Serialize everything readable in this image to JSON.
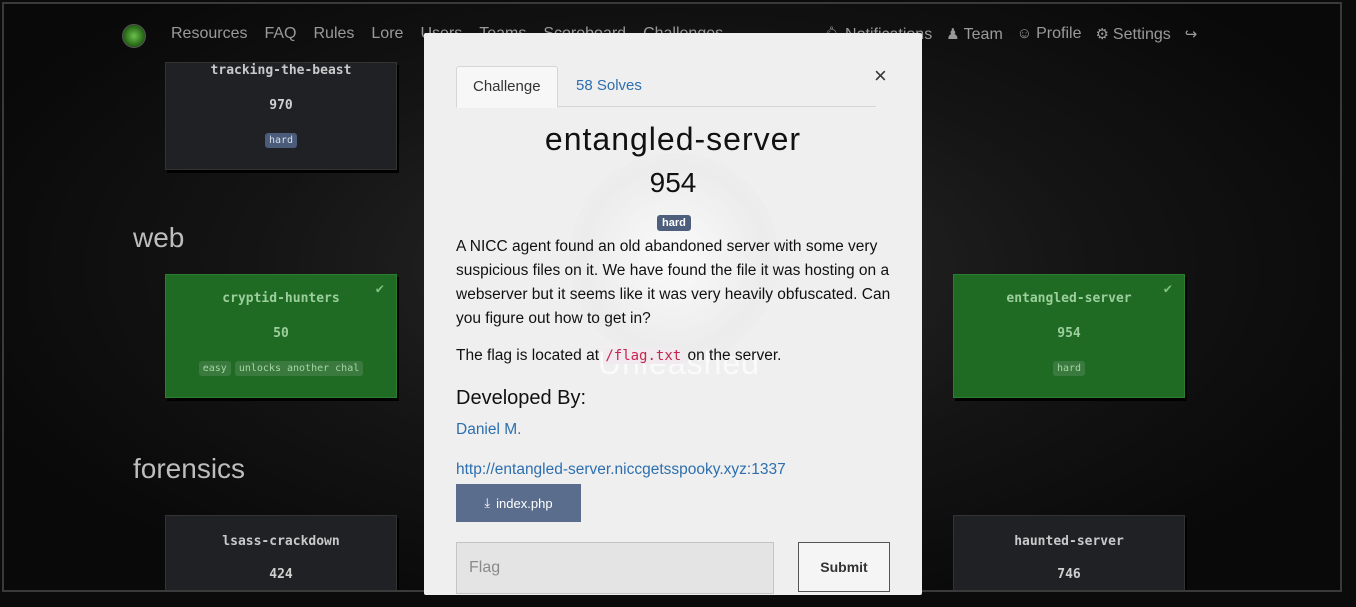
{
  "navbar": {
    "left_links": [
      "Resources",
      "FAQ",
      "Rules",
      "Lore",
      "Users",
      "Teams",
      "Scoreboard",
      "Challenges"
    ],
    "right_links": [
      {
        "icon": "bell-icon",
        "label": "Notifications"
      },
      {
        "icon": "users-icon",
        "label": "Team"
      },
      {
        "icon": "user-circle-icon",
        "label": "Profile"
      },
      {
        "icon": "gears-icon",
        "label": "Settings"
      },
      {
        "icon": "sign-out-icon",
        "label": ""
      }
    ]
  },
  "board": {
    "sections": [
      {
        "title": "web"
      },
      {
        "title": "forensics"
      }
    ],
    "cards": {
      "tracking": {
        "name": "tracking-the-beast",
        "value": "970",
        "tags": [
          "hard"
        ]
      },
      "cryptid": {
        "name": "cryptid-hunters",
        "value": "50",
        "tags": [
          "easy",
          "unlocks another chal"
        ],
        "solved": true
      },
      "entangled": {
        "name": "entangled-server",
        "value": "954",
        "tags": [
          "hard"
        ],
        "solved": true
      },
      "lsass": {
        "name": "lsass-crackdown",
        "value": "424"
      },
      "haunted": {
        "name": "haunted-server",
        "value": "746"
      }
    }
  },
  "modal": {
    "tabs": {
      "challenge": "Challenge",
      "solves": "58 Solves"
    },
    "close": "×",
    "name": "entangled-server",
    "value": "954",
    "tag": "hard",
    "description": "A NICC agent found an old abandoned server with some very suspicious files on it. We have found the file it was hosting on a webserver but it seems like it was very heavily obfuscated. Can you figure out how to get in?",
    "flag_prefix": "The flag is located at ",
    "flag_path": "/flag.txt",
    "flag_suffix": " on the server.",
    "developed_by_title": "Developed By:",
    "developer": "Daniel M.",
    "link": "http://entangled-server.niccgetsspooky.xyz:1337",
    "file_label": "index.php",
    "background_text": "Unleashed",
    "flag_placeholder": "Flag",
    "submit_label": "Submit"
  },
  "colors": {
    "accent": "#2d6fae",
    "tag_bg": "#4d5f7d",
    "solved_card": "#1f6b24",
    "file_button": "#5a6d8c"
  }
}
